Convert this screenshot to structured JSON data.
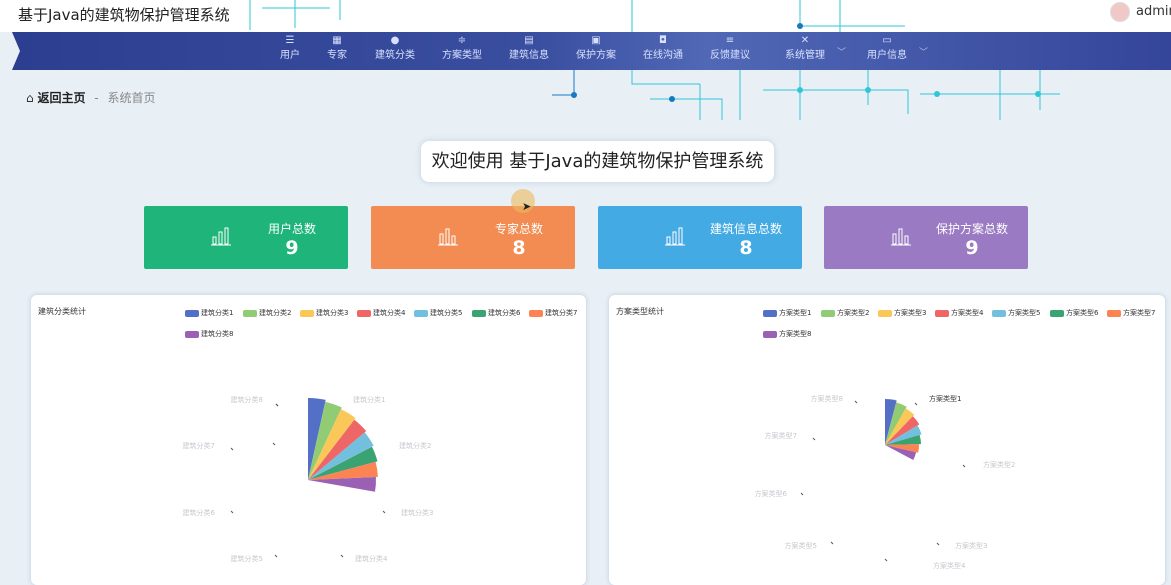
{
  "app": {
    "title": "基于Java的建筑物保护管理系统"
  },
  "user": {
    "name": "admin"
  },
  "nav": [
    {
      "label": "用户",
      "icon": "☰"
    },
    {
      "label": "专家",
      "icon": "▦"
    },
    {
      "label": "建筑分类",
      "icon": "●"
    },
    {
      "label": "方案类型",
      "icon": "≑"
    },
    {
      "label": "建筑信息",
      "icon": "▤"
    },
    {
      "label": "保护方案",
      "icon": "▣"
    },
    {
      "label": "在线沟通",
      "icon": "◘"
    },
    {
      "label": "反馈建议",
      "icon": "≡"
    },
    {
      "label": "系统管理",
      "icon": "✕"
    },
    {
      "label": "用户信息",
      "icon": "▭"
    }
  ],
  "breadcrumb": {
    "home": "返回主页",
    "separator": "-",
    "current": "系统首页"
  },
  "welcome": "欢迎使用 基于Java的建筑物保护管理系统",
  "stats": [
    {
      "label": "用户总数",
      "value": "9",
      "color": "#1fb57a"
    },
    {
      "label": "专家总数",
      "value": "8",
      "color": "#f28c52"
    },
    {
      "label": "建筑信息总数",
      "value": "8",
      "color": "#44aae4"
    },
    {
      "label": "保护方案总数",
      "value": "9",
      "color": "#9b7ac4"
    }
  ],
  "palette": [
    "#5470c6",
    "#91cc75",
    "#fac858",
    "#ee6666",
    "#73c0de",
    "#3ba272",
    "#fc8452",
    "#9a60b4"
  ],
  "chart_data": [
    {
      "type": "pie",
      "title": "建筑分类统计",
      "categories": [
        "建筑分类1",
        "建筑分类2",
        "建筑分类3",
        "建筑分类4",
        "建筑分类5",
        "建筑分类6",
        "建筑分类7",
        "建筑分类8"
      ],
      "values": [
        1,
        1,
        1,
        1,
        1,
        1,
        1,
        1
      ],
      "legend": "top-right"
    },
    {
      "type": "pie",
      "title": "方案类型统计",
      "categories": [
        "方案类型1",
        "方案类型2",
        "方案类型3",
        "方案类型4",
        "方案类型5",
        "方案类型6",
        "方案类型7",
        "方案类型8"
      ],
      "values": [
        1,
        1,
        1,
        1,
        1,
        1,
        1,
        1
      ],
      "legend": "top-right"
    }
  ]
}
